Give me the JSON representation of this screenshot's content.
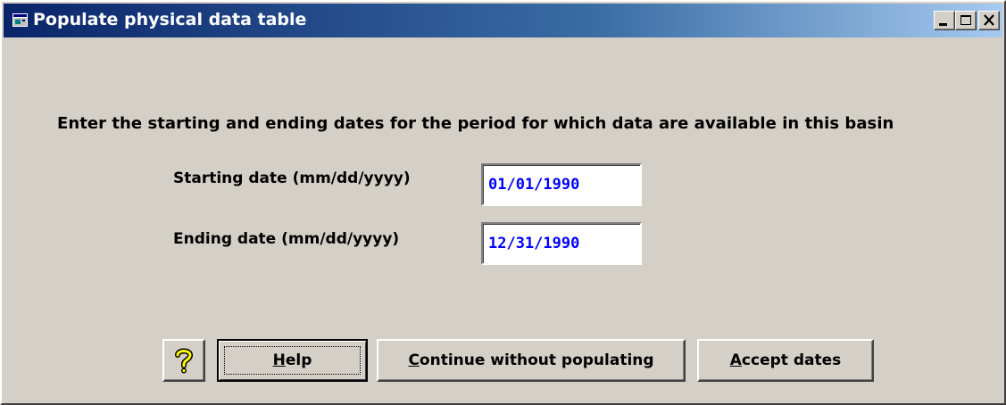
{
  "window": {
    "title": "Populate physical data table"
  },
  "main": {
    "instruction": "Enter the starting and ending dates for the period for which data are available in this basin",
    "start_label": "Starting date (mm/dd/yyyy)",
    "end_label": "Ending date (mm/dd/yyyy)",
    "start_value": "01/01/1990",
    "end_value": "12/31/1990"
  },
  "buttons": {
    "help_mnemonic": "H",
    "help_rest": "elp",
    "continue_mnemonic": "C",
    "continue_rest": "ontinue without populating",
    "accept_mnemonic": "A",
    "accept_rest": "ccept dates"
  },
  "colors": {
    "title_gradient_start": "#0a246a",
    "title_gradient_end": "#a6caf0",
    "dialog_face": "#d4d0c8",
    "input_text": "#0000ff"
  },
  "icons": {
    "app": "window-app-icon",
    "minimize": "minimize-icon",
    "maximize": "maximize-icon",
    "close": "close-icon",
    "help": "question-mark-icon"
  }
}
